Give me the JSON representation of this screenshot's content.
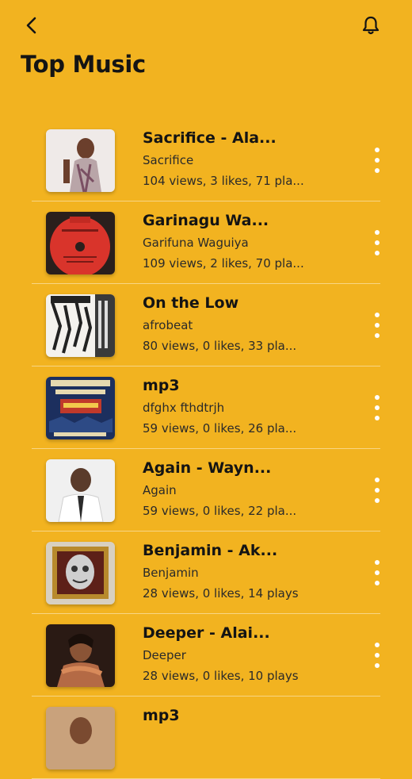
{
  "header": {
    "back_icon": "chevron-left-icon",
    "bell_icon": "bell-icon",
    "title": "Top Music"
  },
  "colors": {
    "background": "#F2B320",
    "text": "#141414",
    "dots": "#FFFFFF"
  },
  "tracks": [
    {
      "title": "Sacrifice - Ala...",
      "subtitle": "Sacrifice",
      "stats": "104 views, 3 likes, 71 pla..."
    },
    {
      "title": "Garinagu Wa...",
      "subtitle": "Garifuna Waguiya",
      "stats": "109 views, 2 likes, 70 pla..."
    },
    {
      "title": "On the Low",
      "subtitle": "afrobeat",
      "stats": "80 views, 0 likes, 33 pla..."
    },
    {
      "title": "mp3",
      "subtitle": "dfghx fthdtrjh",
      "stats": "59 views, 0 likes, 26 pla..."
    },
    {
      "title": "Again - Wayn...",
      "subtitle": "Again",
      "stats": "59 views, 0 likes, 22 pla..."
    },
    {
      "title": "Benjamin - Ak...",
      "subtitle": "Benjamin",
      "stats": "28 views, 0 likes, 14 plays"
    },
    {
      "title": "Deeper - Alai...",
      "subtitle": "Deeper",
      "stats": "28 views, 0 likes, 10 plays"
    },
    {
      "title": "mp3",
      "subtitle": "",
      "stats": ""
    }
  ]
}
